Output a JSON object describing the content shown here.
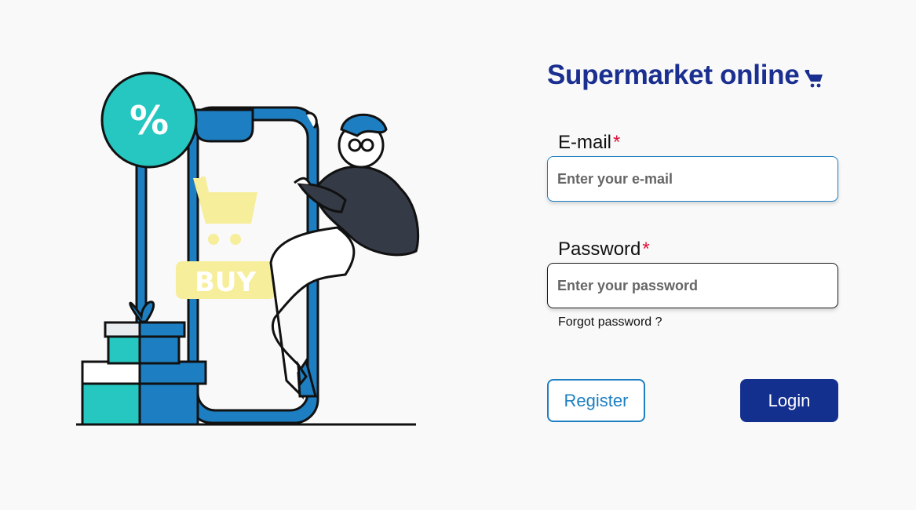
{
  "header": {
    "title": "Supermarket online",
    "cart_icon": "shopping-cart-icon"
  },
  "illustration": {
    "badge_text": "%",
    "buy_text": "BUY",
    "icons": [
      "percent-badge-icon",
      "shopping-cart-icon",
      "gift-box-icon"
    ]
  },
  "form": {
    "email": {
      "label": "E-mail",
      "required_mark": "*",
      "placeholder": "Enter your e-mail",
      "value": ""
    },
    "password": {
      "label": "Password",
      "required_mark": "*",
      "placeholder": "Enter your password",
      "value": ""
    },
    "forgot_label": "Forgot password ?",
    "register_label": "Register",
    "login_label": "Login"
  },
  "colors": {
    "brand": "#1a2f8f",
    "accent": "#1d7fc2",
    "teal": "#26c6c1",
    "required": "#e0103a",
    "login_bg": "#14308f",
    "buy_yellow": "#f6ee9a"
  }
}
